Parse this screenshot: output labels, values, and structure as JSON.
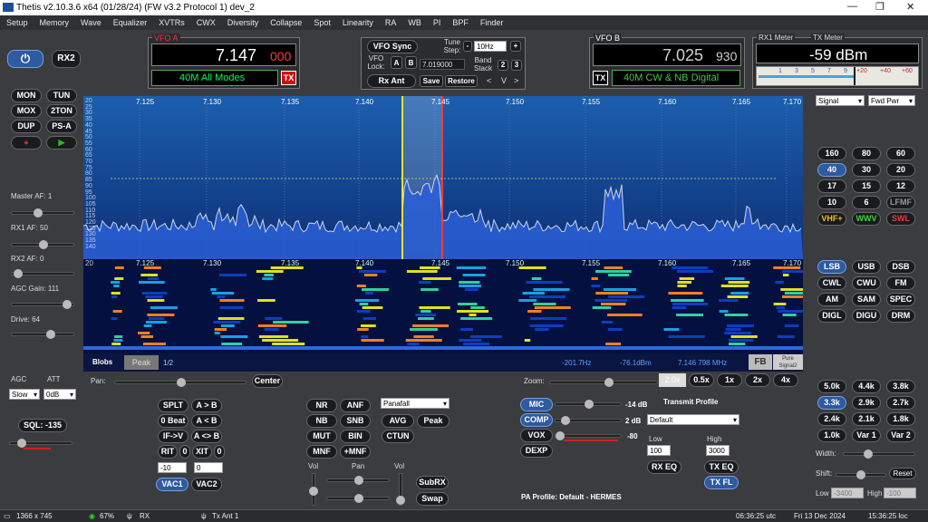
{
  "title": "Thetis v2.10.3.6 x64 (01/28/24) (FW v3.2 Protocol 1) dev_2",
  "menu": [
    "Setup",
    "Memory",
    "Wave",
    "Equalizer",
    "XVTRs",
    "CWX",
    "Diversity",
    "Collapse",
    "Spot",
    "Linearity",
    "RA",
    "WB",
    "PI",
    "BPF",
    "Finder"
  ],
  "left": {
    "rx2": "RX2",
    "buttons": [
      "MON",
      "TUN",
      "MOX",
      "2TON",
      "DUP",
      "PS-A"
    ],
    "master_af": "Master AF:  1",
    "rx1_af": "RX1 AF:  50",
    "rx2_af": "RX2 AF:  0",
    "agc_gain": "AGC Gain:  111",
    "drive": "Drive:  64",
    "agc": "AGC",
    "att": "ATT",
    "agc_val": "Slow",
    "att_val": "0dB",
    "sql": "SQL: -135"
  },
  "vfoa": {
    "title": "VFO A",
    "freq": "7.147",
    "freq_small": "000",
    "mode": "40M All Modes",
    "tx": "TX"
  },
  "vfob": {
    "title": "VFO B",
    "freq": "7.025",
    "freq_small": "930",
    "mode": "40M CW & NB Digital",
    "tx": "TX"
  },
  "center": {
    "sync": "VFO Sync",
    "tune_step": "Tune Step:",
    "minus": "-",
    "plus": "+",
    "step_val": "10Hz",
    "vfo_lock": "VFO Lock:",
    "a": "A",
    "b": "B",
    "lock_freq": "7.019000",
    "band_stack": "Band Stack",
    "s2": "2",
    "s3": "3",
    "rx_ant": "Rx Ant",
    "save": "Save",
    "restore": "Restore",
    "lt": "<",
    "v": "V",
    ">": ">"
  },
  "meter": {
    "rx1": "RX1 Meter",
    "tx": "TX Meter",
    "value": "-59 dBm",
    "scale": [
      "1",
      "3",
      "5",
      "7",
      "9",
      "+20",
      "+40",
      "+60"
    ],
    "sel1": "Signal",
    "sel2": "Fwd Pwr"
  },
  "spectrum": {
    "freqs": [
      "7.125",
      "7.130",
      "7.135",
      "7.140",
      "7.145",
      "7.150",
      "7.155",
      "7.160",
      "7.165",
      "7.170"
    ],
    "db": [
      "20",
      "25",
      "30",
      "35",
      "40",
      "45",
      "50",
      "55",
      "60",
      "65",
      "70",
      "75",
      "80",
      "85",
      "90",
      "95",
      "100",
      "105",
      "110",
      "115",
      "120",
      "125",
      "130",
      "135",
      "140"
    ],
    "wf_left": "20",
    "blobs": "Blobs",
    "peak": "Peak",
    "page": "1/2",
    "hz": "-201.7Hz",
    "dbm": "-76.1dBm",
    "mhz": "7.146 798 MHz",
    "fb": "FB",
    "pure": "Pure Signal2"
  },
  "bands": [
    "160",
    "80",
    "60",
    "40",
    "30",
    "20",
    "17",
    "15",
    "12",
    "10",
    "6",
    "LFMF",
    "VHF+",
    "WWV",
    "SWL"
  ],
  "modes": [
    "LSB",
    "USB",
    "DSB",
    "CWL",
    "CWU",
    "FM",
    "AM",
    "SAM",
    "SPEC",
    "DIGL",
    "DIGU",
    "DRM"
  ],
  "filters": [
    "5.0k",
    "4.4k",
    "3.8k",
    "3.3k",
    "2.9k",
    "2.7k",
    "2.4k",
    "2.1k",
    "1.8k",
    "1.0k",
    "Var 1",
    "Var 2"
  ],
  "filt_right": {
    "width": "Width:",
    "shift": "Shift:",
    "reset": "Reset",
    "low": "Low",
    "low_val": "-3400",
    "high": "High",
    "high_val": "-100"
  },
  "pan": {
    "pan": "Pan:",
    "center": "Center",
    "zoom": "Zoom:",
    "z": [
      "0.5x",
      "1x",
      "2x",
      "4x"
    ],
    "z0": "2.0x"
  },
  "dsp": {
    "left": [
      "SPLT",
      "A > B",
      "0 Beat",
      "A < B",
      "IF->V",
      "A <> B",
      "RIT",
      "0",
      "XIT",
      "0"
    ],
    "rit_val": "-10",
    "xit_val": "0",
    "vac1": "VAC1",
    "vac2": "VAC2",
    "nr": [
      "NR",
      "ANF",
      "NB",
      "SNB",
      "MUT",
      "BIN",
      "MNF",
      "+MNF"
    ],
    "display_sel": "Panafall",
    "avg": "AVG",
    "peak": "Peak",
    "ctun": "CTUN",
    "vol": "Vol",
    "pan": "Pan",
    "vol2": "Vol",
    "subrx": "SubRX",
    "swap": "Swap"
  },
  "tx": {
    "mic": "MIC",
    "mic_val": "-14 dB",
    "comp": "COMP",
    "comp_val": "2 dB",
    "vox": "VOX",
    "vox_val": "-80",
    "dexp": "DEXP",
    "profile_title": "Transmit Profile",
    "profile": "Default",
    "low": "Low",
    "high": "High",
    "low_val": "100",
    "high_val": "3000",
    "rxeq": "RX EQ",
    "txeq": "TX EQ",
    "txfl": "TX FL",
    "pa": "PA Profile: Default - HERMES"
  },
  "status": {
    "res": "1366 x 745",
    "cpu": "67%",
    "rx": "RX",
    "txant": "Tx Ant 1",
    "utc": "06:36:25 utc",
    "date": "Fri 13 Dec 2024",
    "loc": "15:36:25 loc"
  },
  "colors": {
    "accent": "#2d5aa0",
    "spectrum_bg": "#1c4a9a",
    "trace": "#cfd6e6",
    "vfo_text": "#ffffff",
    "mode_text": "#00ff5a",
    "tx_red": "#d01010"
  }
}
